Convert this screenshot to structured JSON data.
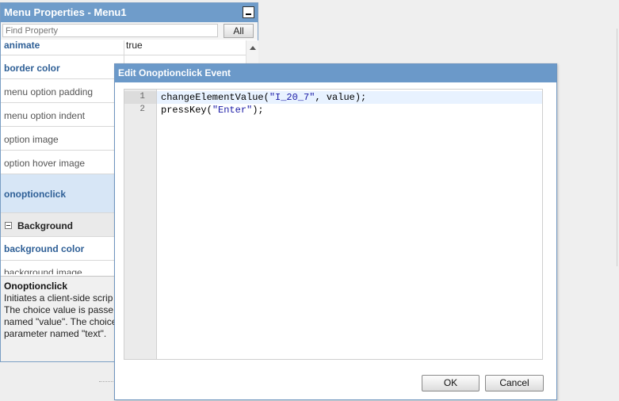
{
  "panel": {
    "title": "Menu Properties - Menu1",
    "search_placeholder": "Find Property",
    "all_button": "All",
    "properties": [
      {
        "name": "animate",
        "value": "true",
        "bold": true
      },
      {
        "name": "border color",
        "value": "",
        "bold": true
      },
      {
        "name": "menu option padding",
        "value": "",
        "bold": false
      },
      {
        "name": "menu option indent",
        "value": "",
        "bold": false
      },
      {
        "name": "option image",
        "value": "",
        "bold": false
      },
      {
        "name": "option hover image",
        "value": "",
        "bold": false
      },
      {
        "name": "onoptionclick",
        "value": "",
        "bold": true,
        "selected": true
      }
    ],
    "section": {
      "label": "Background"
    },
    "background_properties": [
      {
        "name": "background color",
        "value": "",
        "bold": true
      },
      {
        "name": "background image",
        "value": "",
        "bold": false
      }
    ],
    "description": {
      "title": "Onoptionclick",
      "lines": [
        "Initiates a client-side scrip",
        "The choice value is passe",
        "named \"value\". The choice",
        "parameter named \"text\"."
      ]
    }
  },
  "dialog": {
    "title": "Edit Onoptionclick Event",
    "code": {
      "line_numbers": [
        "1",
        "2"
      ],
      "line1": {
        "fn": "changeElementValue(",
        "str": "\"I_20_7\"",
        "rest": ", value);"
      },
      "line2": {
        "fn": "pressKey(",
        "str": "\"Enter\"",
        "rest": ");"
      }
    },
    "ok_label": "OK",
    "cancel_label": "Cancel"
  },
  "colors": {
    "title_bar": "#6f9cca",
    "property_name_bold": "#2e5f96",
    "selected_row": "#d7e6f6",
    "code_string": "#1a1aa6"
  },
  "icons": {
    "minimize": "minimize-icon",
    "collapse": "collapse-section-icon",
    "scroll_up": "scroll-up-arrow-icon"
  }
}
